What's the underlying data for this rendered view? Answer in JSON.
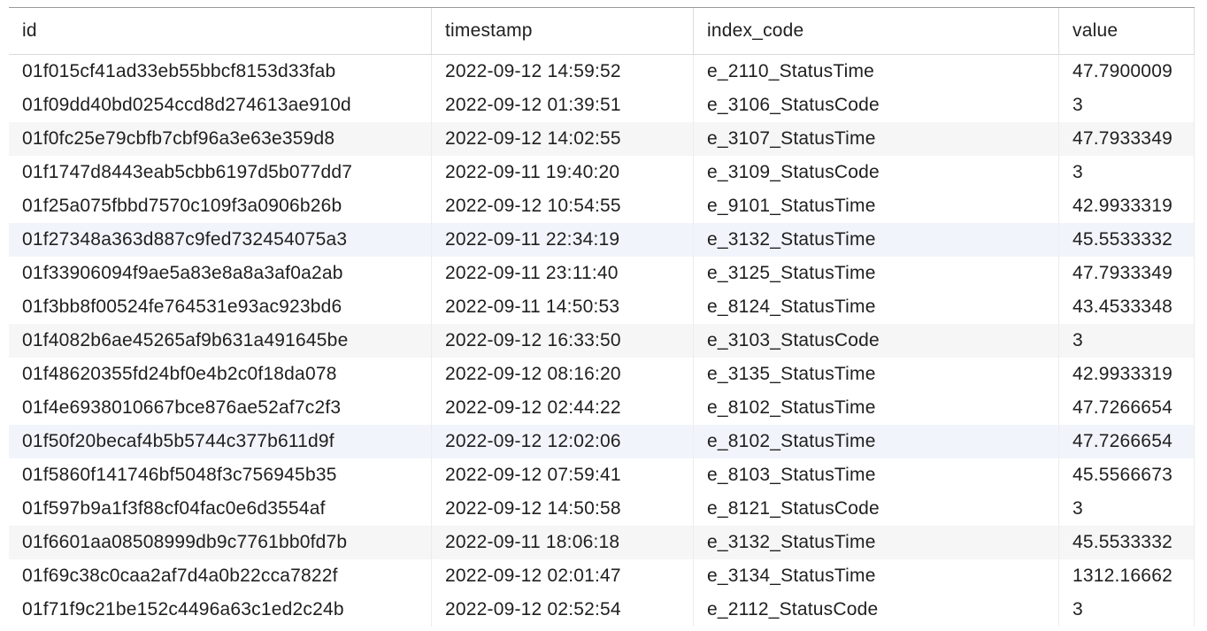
{
  "columns": [
    "id",
    "timestamp",
    "index_code",
    "value"
  ],
  "rows": [
    {
      "id": "01f015cf41ad33eb55bbcf8153d33fab",
      "timestamp": "2022-09-12 14:59:52",
      "index_code": "e_2110_StatusTime",
      "value": "47.7900009"
    },
    {
      "id": "01f09dd40bd0254ccd8d274613ae910d",
      "timestamp": "2022-09-12 01:39:51",
      "index_code": "e_3106_StatusCode",
      "value": "3"
    },
    {
      "id": "01f0fc25e79cbfb7cbf96a3e63e359d8",
      "timestamp": "2022-09-12 14:02:55",
      "index_code": "e_3107_StatusTime",
      "value": "47.7933349"
    },
    {
      "id": "01f1747d8443eab5cbb6197d5b077dd7",
      "timestamp": "2022-09-11 19:40:20",
      "index_code": "e_3109_StatusCode",
      "value": "3"
    },
    {
      "id": "01f25a075fbbd7570c109f3a0906b26b",
      "timestamp": "2022-09-12 10:54:55",
      "index_code": "e_9101_StatusTime",
      "value": "42.9933319"
    },
    {
      "id": "01f27348a363d887c9fed732454075a3",
      "timestamp": "2022-09-11 22:34:19",
      "index_code": "e_3132_StatusTime",
      "value": "45.5533332"
    },
    {
      "id": "01f33906094f9ae5a83e8a8a3af0a2ab",
      "timestamp": "2022-09-11 23:11:40",
      "index_code": "e_3125_StatusTime",
      "value": "47.7933349"
    },
    {
      "id": "01f3bb8f00524fe764531e93ac923bd6",
      "timestamp": "2022-09-11 14:50:53",
      "index_code": "e_8124_StatusTime",
      "value": "43.4533348"
    },
    {
      "id": "01f4082b6ae45265af9b631a491645be",
      "timestamp": "2022-09-12 16:33:50",
      "index_code": "e_3103_StatusCode",
      "value": "3"
    },
    {
      "id": "01f48620355fd24bf0e4b2c0f18da078",
      "timestamp": "2022-09-12 08:16:20",
      "index_code": "e_3135_StatusTime",
      "value": "42.9933319"
    },
    {
      "id": "01f4e6938010667bce876ae52af7c2f3",
      "timestamp": "2022-09-12 02:44:22",
      "index_code": "e_8102_StatusTime",
      "value": "47.7266654"
    },
    {
      "id": "01f50f20becaf4b5b5744c377b611d9f",
      "timestamp": "2022-09-12 12:02:06",
      "index_code": "e_8102_StatusTime",
      "value": "47.7266654"
    },
    {
      "id": "01f5860f141746bf5048f3c756945b35",
      "timestamp": "2022-09-12 07:59:41",
      "index_code": "e_8103_StatusTime",
      "value": "45.5566673"
    },
    {
      "id": "01f597b9a1f3f88cf04fac0e6d3554af",
      "timestamp": "2022-09-12 14:50:58",
      "index_code": "e_8121_StatusCode",
      "value": "3"
    },
    {
      "id": "01f6601aa08508999db9c7761bb0fd7b",
      "timestamp": "2022-09-11 18:06:18",
      "index_code": "e_3132_StatusTime",
      "value": "45.5533332"
    },
    {
      "id": "01f69c38c0caa2af7d4a0b22cca7822f",
      "timestamp": "2022-09-12 02:01:47",
      "index_code": "e_3134_StatusTime",
      "value": "1312.16662"
    },
    {
      "id": "01f71f9c21be152c4496a63c1ed2c24b",
      "timestamp": "2022-09-12 02:52:54",
      "index_code": "e_2112_StatusCode",
      "value": "3"
    }
  ]
}
